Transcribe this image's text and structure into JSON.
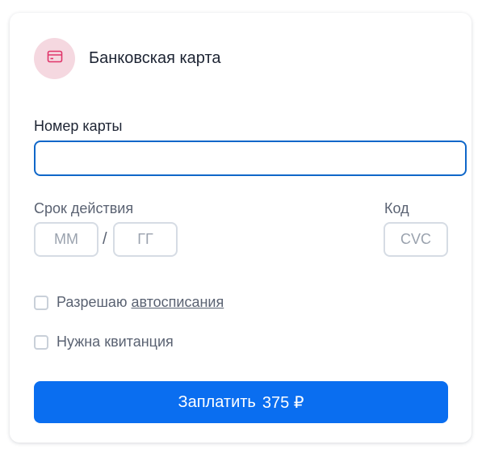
{
  "header": {
    "title": "Банковская карта",
    "icon": "credit-card-icon",
    "icon_color": "#e0356a",
    "icon_bg": "#f5d8e0"
  },
  "card_number": {
    "label": "Номер карты",
    "value": "",
    "placeholder": ""
  },
  "expiry": {
    "label": "Срок действия",
    "month_placeholder": "ММ",
    "separator": "/",
    "year_placeholder": "ГГ"
  },
  "cvc": {
    "label": "Код",
    "placeholder": "CVC"
  },
  "checkboxes": [
    {
      "label": "Разрешаю",
      "link": "автосписания",
      "checked": false
    },
    {
      "label": "Нужна квитанция",
      "checked": false
    }
  ],
  "pay_button": {
    "label": "Заплатить",
    "amount": "375 ₽",
    "color": "#0a6ef0"
  },
  "colors": {
    "focus_border": "#0f67c9",
    "input_border": "#d6dce4"
  }
}
